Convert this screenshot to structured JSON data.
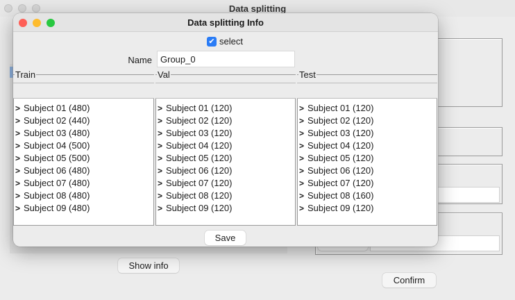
{
  "background_window": {
    "title": "Data splitting",
    "show_info_label": "Show info",
    "confirm_label": "Confirm"
  },
  "dialog": {
    "title": "Data splitting Info",
    "select_label": "select",
    "select_checked": true,
    "name_label": "Name",
    "name_value": "Group_0",
    "save_label": "Save",
    "columns": [
      {
        "title": "Train",
        "items": [
          "Subject 01 (480)",
          "Subject 02 (440)",
          "Subject 03 (480)",
          "Subject 04 (500)",
          "Subject 05 (500)",
          "Subject 06 (480)",
          "Subject 07 (480)",
          "Subject 08 (480)",
          "Subject 09 (480)"
        ]
      },
      {
        "title": "Val",
        "items": [
          "Subject 01 (120)",
          "Subject 02 (120)",
          "Subject 03 (120)",
          "Subject 04 (120)",
          "Subject 05 (120)",
          "Subject 06 (120)",
          "Subject 07 (120)",
          "Subject 08 (120)",
          "Subject 09 (120)"
        ]
      },
      {
        "title": "Test",
        "items": [
          "Subject 01 (120)",
          "Subject 02 (120)",
          "Subject 03 (120)",
          "Subject 04 (120)",
          "Subject 05 (120)",
          "Subject 06 (120)",
          "Subject 07 (120)",
          "Subject 08 (160)",
          "Subject 09 (120)"
        ]
      }
    ]
  },
  "colors": {
    "close": "#fe5f57",
    "minimize": "#febc2e",
    "zoom": "#28c840",
    "accent": "#2a7cf6"
  }
}
